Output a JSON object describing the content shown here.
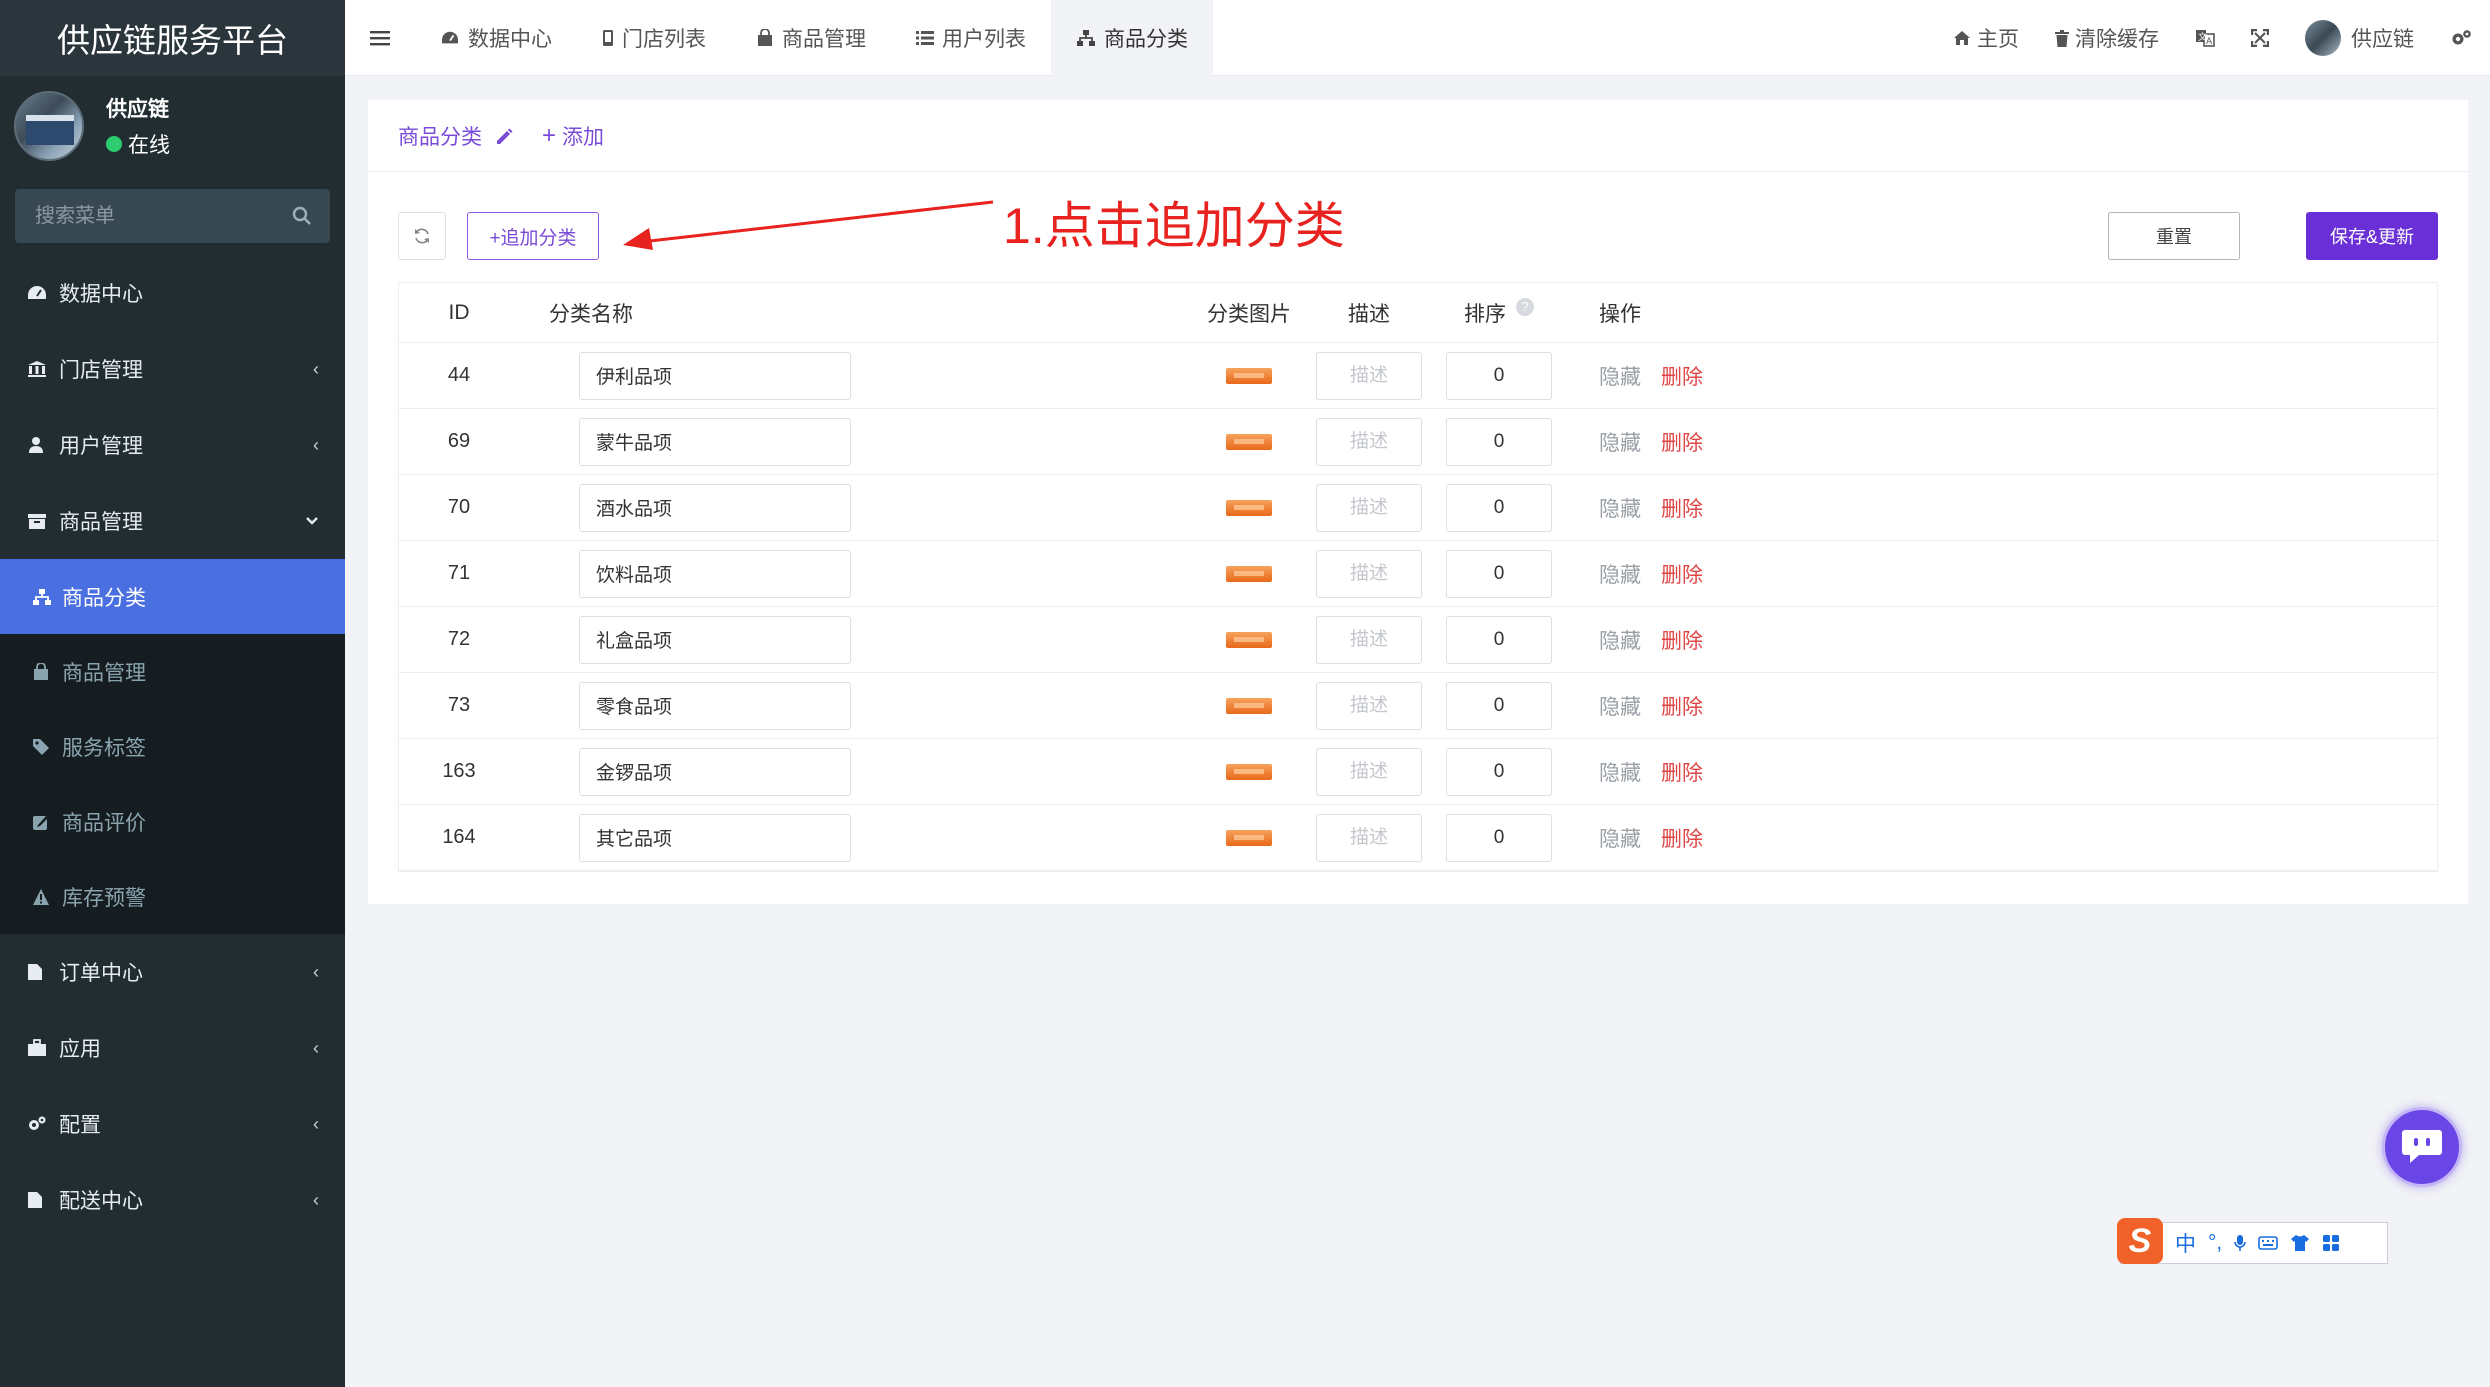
{
  "sidebar": {
    "brand": "供应链服务平台",
    "user": {
      "name": "供应链",
      "status": "在线"
    },
    "search_placeholder": "搜索菜单",
    "menu": [
      {
        "label": "数据中心",
        "icon": "dashboard-icon"
      },
      {
        "label": "门店管理",
        "icon": "bank-icon"
      },
      {
        "label": "用户管理",
        "icon": "user-icon"
      },
      {
        "label": "商品管理",
        "icon": "archive-icon"
      }
    ],
    "submenu": [
      {
        "label": "商品分类",
        "icon": "sitemap-icon",
        "active": true
      },
      {
        "label": "商品管理",
        "icon": "bag-icon"
      },
      {
        "label": "服务标签",
        "icon": "tag-icon"
      },
      {
        "label": "商品评价",
        "icon": "edit-icon"
      },
      {
        "label": "库存预警",
        "icon": "warning-icon"
      }
    ],
    "menu_after": [
      {
        "label": "订单中心",
        "icon": "file-icon"
      },
      {
        "label": "应用",
        "icon": "briefcase-icon"
      },
      {
        "label": "配置",
        "icon": "cogs-icon"
      },
      {
        "label": "配送中心",
        "icon": "file-icon"
      }
    ]
  },
  "header": {
    "tabs": [
      {
        "label": "数据中心"
      },
      {
        "label": "门店列表"
      },
      {
        "label": "商品管理"
      },
      {
        "label": "用户列表"
      },
      {
        "label": "商品分类",
        "active": true
      }
    ],
    "right": {
      "home": "主页",
      "clear_cache": "清除缓存",
      "user": "供应链"
    }
  },
  "content": {
    "breadcrumb": "商品分类",
    "add_link": "添加",
    "add_category_btn": "+追加分类",
    "annotation": "1.点击追加分类",
    "reset_btn": "重置",
    "save_btn": "保存&更新",
    "columns": {
      "id": "ID",
      "name": "分类名称",
      "image": "分类图片",
      "desc": "描述",
      "sort": "排序",
      "op": "操作"
    },
    "desc_placeholder": "描述",
    "op_hide": "隐藏",
    "op_delete": "删除",
    "rows": [
      {
        "id": "44",
        "name": "伊利品项",
        "sort": "0"
      },
      {
        "id": "69",
        "name": "蒙牛品项",
        "sort": "0"
      },
      {
        "id": "70",
        "name": "酒水品项",
        "sort": "0"
      },
      {
        "id": "71",
        "name": "饮料品项",
        "sort": "0"
      },
      {
        "id": "72",
        "name": "礼盒品项",
        "sort": "0"
      },
      {
        "id": "73",
        "name": "零食品项",
        "sort": "0"
      },
      {
        "id": "163",
        "name": "金锣品项",
        "sort": "0"
      },
      {
        "id": "164",
        "name": "其它品项",
        "sort": "0"
      }
    ]
  },
  "ime": {
    "logo": "S",
    "mode": "中"
  }
}
